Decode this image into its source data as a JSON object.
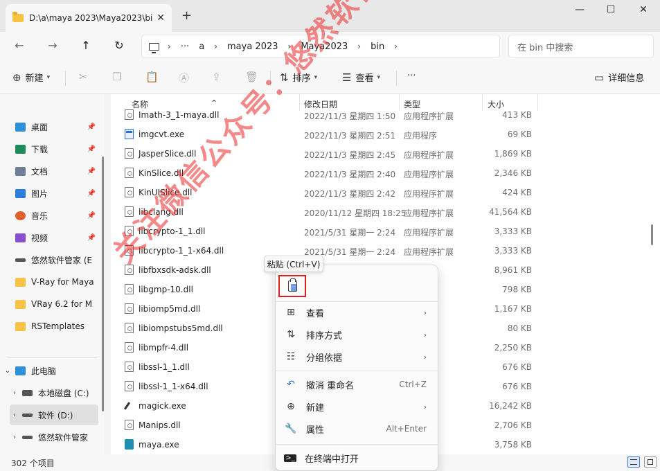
{
  "window": {
    "tab_title": "D:\\a\\maya 2023\\Maya2023\\bi",
    "tab_close": "✕",
    "new_tab": "+",
    "minimize": "—",
    "maximize": "☐",
    "close": "✕"
  },
  "address": {
    "crumbs": [
      "···",
      "a",
      "maya 2023",
      "Maya2023",
      "bin"
    ],
    "separator": "›",
    "search_placeholder": "在 bin 中搜索"
  },
  "toolbar": {
    "new_label": "新建",
    "sort_label": "排序",
    "view_label": "查看",
    "more_label": "···",
    "details_label": "详细信息"
  },
  "sidebar": {
    "items": [
      {
        "label": "桌面",
        "color": "#2b8fd9"
      },
      {
        "label": "下载",
        "color": "#1c8c5a"
      },
      {
        "label": "文档",
        "color": "#6e7f95"
      },
      {
        "label": "图片",
        "color": "#2b7fd9"
      },
      {
        "label": "音乐",
        "color": "#e0602b"
      },
      {
        "label": "视频",
        "color": "#8a4fd0"
      },
      {
        "label": "悠然软件管家 (E",
        "color": "#555555"
      },
      {
        "label": "V-Ray  for Maya",
        "color": "#f6c344"
      },
      {
        "label": "VRay 6.2 for M",
        "color": "#f6c344"
      },
      {
        "label": "RSTemplates",
        "color": "#f6c344"
      },
      {
        "label": "此电脑",
        "color": "#2b8fd9"
      },
      {
        "label": "本地磁盘 (C:)",
        "color": "#555555"
      },
      {
        "label": "软件 (D:)",
        "color": "#555555"
      },
      {
        "label": "悠然软件管家",
        "color": "#555555"
      }
    ]
  },
  "columns": {
    "name": "名称",
    "date": "修改日期",
    "type": "类型",
    "size": "大小"
  },
  "files": [
    {
      "name": "Imath-3_1-maya.dll",
      "date": "2022/11/3 星期四 1:50",
      "type": "应用程序扩展",
      "size": "413 KB",
      "kind": "dll"
    },
    {
      "name": "imgcvt.exe",
      "date": "2022/11/3 星期四 2:51",
      "type": "应用程序",
      "size": "69 KB",
      "kind": "exe"
    },
    {
      "name": "JasperSlice.dll",
      "date": "2022/11/3 星期四 2:45",
      "type": "应用程序扩展",
      "size": "1,869 KB",
      "kind": "dll"
    },
    {
      "name": "KinSlice.dll",
      "date": "2022/11/3 星期四 2:40",
      "type": "应用程序扩展",
      "size": "2,346 KB",
      "kind": "dll"
    },
    {
      "name": "KinUISlice.dll",
      "date": "2022/11/3 星期四 2:42",
      "type": "应用程序扩展",
      "size": "424 KB",
      "kind": "dll"
    },
    {
      "name": "libclang.dll",
      "date": "2020/11/12 星期四 18:25",
      "type": "应用程序扩展",
      "size": "41,564 KB",
      "kind": "dll"
    },
    {
      "name": "libcrypto-1_1.dll",
      "date": "2021/5/31 星期一 2:24",
      "type": "应用程序扩展",
      "size": "3,333 KB",
      "kind": "dll"
    },
    {
      "name": "libcrypto-1_1-x64.dll",
      "date": "2021/5/31 星期一 2:24",
      "type": "应用程序扩展",
      "size": "3,333 KB",
      "kind": "dll"
    },
    {
      "name": "libfbxsdk-adsk.dll",
      "date": "",
      "type": "展",
      "size": "8,961 KB",
      "kind": "dll"
    },
    {
      "name": "libgmp-10.dll",
      "date": "",
      "type": "展",
      "size": "798 KB",
      "kind": "dll"
    },
    {
      "name": "libiomp5md.dll",
      "date": "",
      "type": "展",
      "size": "1,167 KB",
      "kind": "dll"
    },
    {
      "name": "libiompstubs5md.dll",
      "date": "",
      "type": "展",
      "size": "80 KB",
      "kind": "dll"
    },
    {
      "name": "libmpfr-4.dll",
      "date": "",
      "type": "展",
      "size": "2,250 KB",
      "kind": "dll"
    },
    {
      "name": "libssl-1_1.dll",
      "date": "",
      "type": "展",
      "size": "676 KB",
      "kind": "dll"
    },
    {
      "name": "libssl-1_1-x64.dll",
      "date": "",
      "type": "展",
      "size": "676 KB",
      "kind": "dll"
    },
    {
      "name": "magick.exe",
      "date": "",
      "type": "",
      "size": "16,242 KB",
      "kind": "magick"
    },
    {
      "name": "Manips.dll",
      "date": "",
      "type": "展",
      "size": "2,706 KB",
      "kind": "dll"
    },
    {
      "name": "maya.exe",
      "date": "",
      "type": "",
      "size": "3,758 KB",
      "kind": "maya"
    }
  ],
  "status": {
    "count": "302 个项目"
  },
  "tooltip": {
    "text": "粘贴 (Ctrl+V)"
  },
  "context_menu": {
    "items": [
      {
        "label": "查看",
        "icon": "grid-icon",
        "shortcut": "",
        "submenu": true
      },
      {
        "label": "排序方式",
        "icon": "sort-icon",
        "shortcut": "",
        "submenu": true
      },
      {
        "label": "分组依据",
        "icon": "group-icon",
        "shortcut": "",
        "submenu": true
      },
      {
        "label": "撤消 重命名",
        "icon": "undo-icon",
        "shortcut": "Ctrl+Z",
        "submenu": false
      },
      {
        "label": "新建",
        "icon": "new-icon",
        "shortcut": "",
        "submenu": true
      },
      {
        "label": "属性",
        "icon": "wrench-icon",
        "shortcut": "Alt+Enter",
        "submenu": false
      },
      {
        "label": "在终端中打开",
        "icon": "terminal-icon",
        "shortcut": "",
        "submenu": false
      }
    ]
  },
  "watermark": {
    "text": "关注微信公众号：悠然软件管家"
  }
}
